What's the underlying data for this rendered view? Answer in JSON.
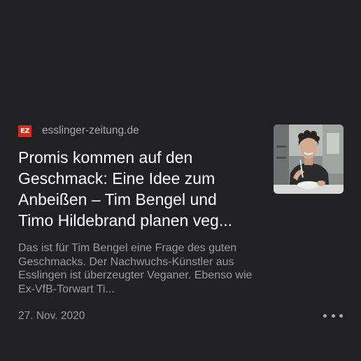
{
  "article": {
    "source_logo_text": "EZ",
    "source_name": "esslinger-zeitung.de",
    "headline": "Promis kommen auf den Geschmack: Eine Idee zum Anbeißen – Tim Bengel und Timo Hildebrand planen veg...",
    "summary": "Das ist für Tim Bengel eine Frage des guten Geschmacks. Der Nachwuchs-Künstler aus Esslingen ist überzeugter Veganer. Ebenso wie Ex-VfB-Torwart Ti...",
    "date": "27. Nov. 2020"
  },
  "colors": {
    "background": "#212124",
    "logo_red": "#d52b1e",
    "text_primary": "#ffffff",
    "text_secondary": "#9a9a9f"
  },
  "icons": {
    "more": "more-horizontal-icon"
  }
}
